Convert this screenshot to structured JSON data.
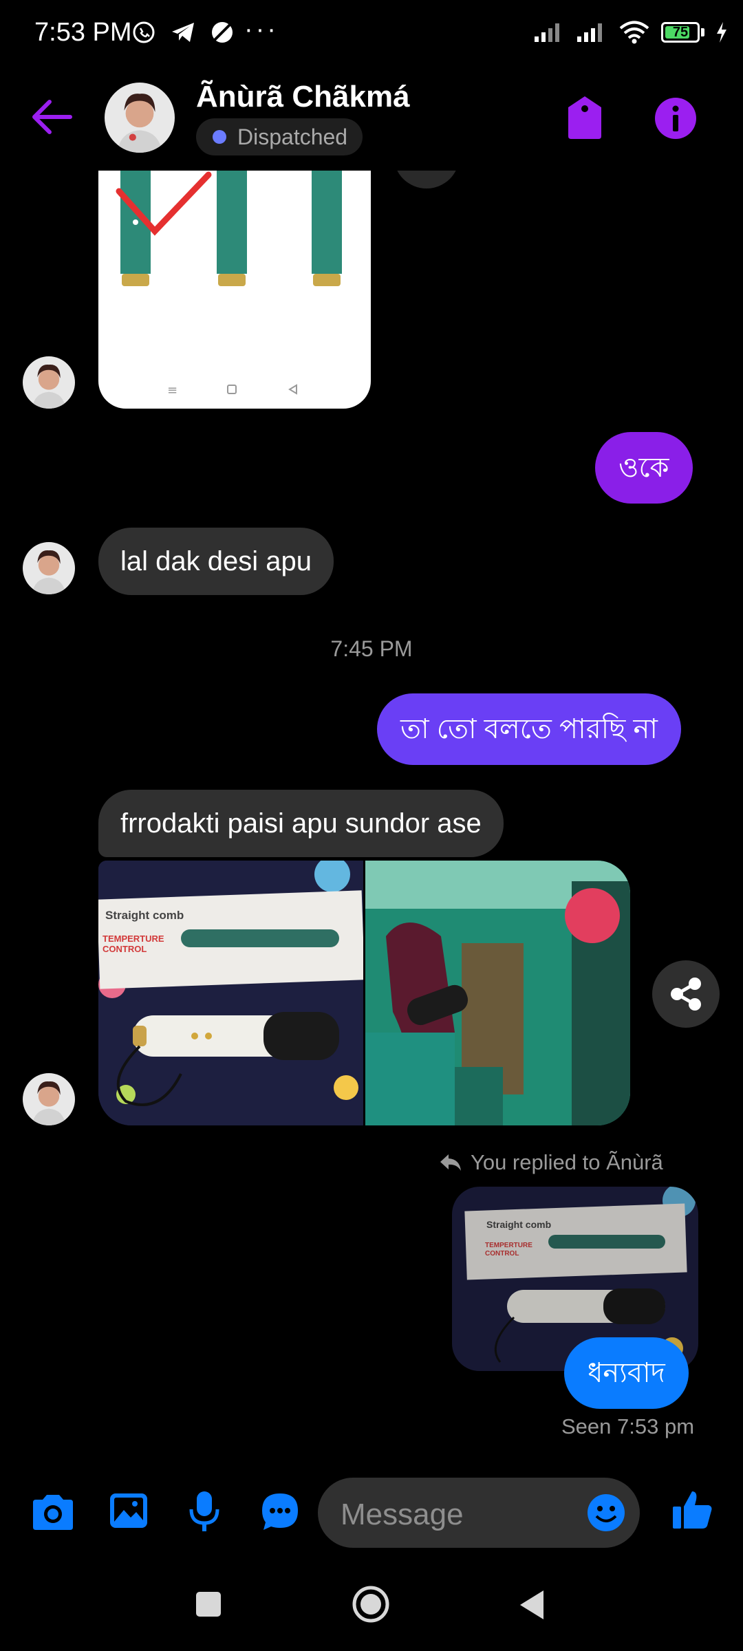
{
  "status_bar": {
    "time": "7:53 PM",
    "more": "···",
    "battery": "75"
  },
  "header": {
    "contact_name": "Ãnùrã Chãkmá",
    "status": "Dispatched"
  },
  "messages": {
    "out_okay": "ওকে",
    "in_red_one": "lal dak desi apu",
    "timestamp": "7:45 PM",
    "out_cant_say": "তা তো বলতে পারছি না",
    "in_product": "frrodakti paisi apu sundor ase",
    "reply_label": "You replied to Ãnùrã",
    "out_thanks": "ধন্যবাদ",
    "seen": "Seen 7:53 pm"
  },
  "product_box": {
    "brand": "Straight comb",
    "line1": "TEMPERTURE",
    "line2": "CONTROL"
  },
  "composer": {
    "placeholder": "Message"
  },
  "colors": {
    "accent": "#a020f0",
    "purple": "#8a1fe8",
    "indigo": "#6a3ff5",
    "blue": "#0a7cff"
  }
}
